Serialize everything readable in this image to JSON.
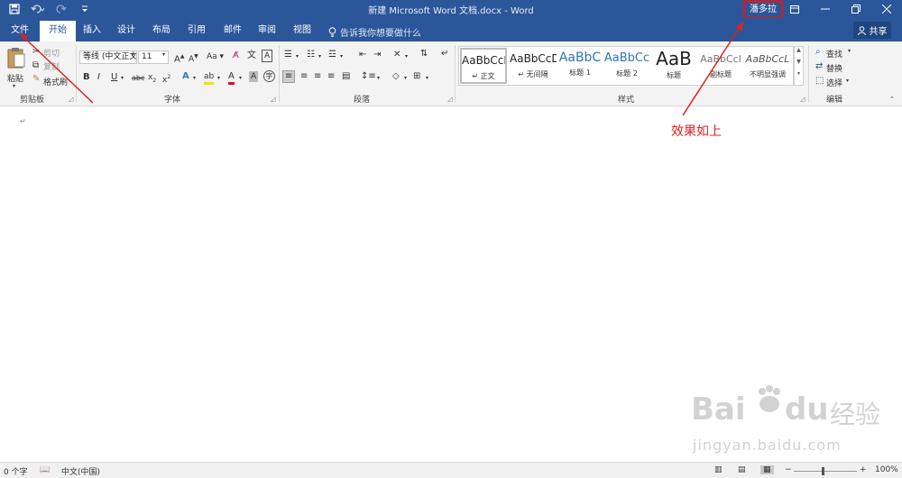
{
  "window": {
    "title": "新建 Microsoft Word 文档.docx - Word",
    "user_name": "潘多拉"
  },
  "quick_access": {
    "icons": [
      "save-icon",
      "undo-icon",
      "redo-icon",
      "customize-qat-icon"
    ]
  },
  "tabs": [
    {
      "label": "文件"
    },
    {
      "label": "开始"
    },
    {
      "label": "插入"
    },
    {
      "label": "设计"
    },
    {
      "label": "布局"
    },
    {
      "label": "引用"
    },
    {
      "label": "邮件"
    },
    {
      "label": "审阅"
    },
    {
      "label": "视图"
    }
  ],
  "tell_me": "告诉我你想要做什么",
  "share": "共享",
  "clipboard": {
    "paste": "粘贴",
    "cut": "剪切",
    "copy": "复制",
    "format_painter": "格式刷",
    "group": "剪贴板"
  },
  "font": {
    "family": "等线 (中文正文)",
    "size": "11",
    "change_case": "Aa",
    "group": "字体"
  },
  "paragraph": {
    "group": "段落"
  },
  "styles": {
    "items": [
      {
        "preview": "AaBbCcD",
        "name": "↵ 正文"
      },
      {
        "preview": "AaBbCcD",
        "name": "↵ 无间隔"
      },
      {
        "preview": "AaBbC",
        "name": "标题 1"
      },
      {
        "preview": "AaBbCc",
        "name": "标题 2"
      },
      {
        "preview": "AaB",
        "name": "标题"
      },
      {
        "preview": "AaBbCcl",
        "name": "副标题"
      },
      {
        "preview": "AaBbCcL",
        "name": "不明显强调"
      }
    ],
    "group": "样式"
  },
  "editing": {
    "find": "查找",
    "replace": "替换",
    "select": "选择",
    "group": "编辑"
  },
  "document": {
    "paragraph_mark": "↵",
    "annotation": "效果如上"
  },
  "watermark": {
    "brand": "Bai",
    "brand2": "du",
    "cn": "经验",
    "url": "jingyan.baidu.com"
  },
  "statusbar": {
    "word_count": "0 个字",
    "language": "中文(中国)",
    "zoom": "100%"
  },
  "colors": {
    "accent": "#2b579a",
    "annotation": "#e02020"
  }
}
